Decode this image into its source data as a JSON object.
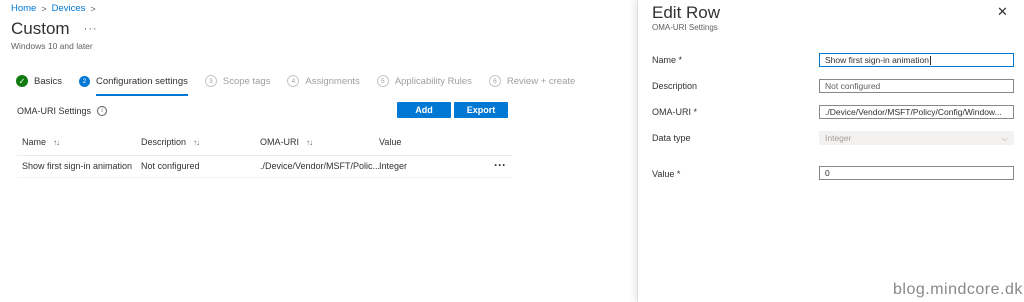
{
  "breadcrumb": {
    "home": "Home",
    "devices": "Devices",
    "sep": ">"
  },
  "page": {
    "title": "Custom",
    "more": "···",
    "subtitle": "Windows 10 and later"
  },
  "steps": [
    {
      "num": "✓",
      "label": "Basics",
      "state": "done"
    },
    {
      "num": "2",
      "label": "Configuration settings",
      "state": "active"
    },
    {
      "num": "3",
      "label": "Scope tags",
      "state": "pending"
    },
    {
      "num": "4",
      "label": "Assignments",
      "state": "pending"
    },
    {
      "num": "5",
      "label": "Applicability Rules",
      "state": "pending"
    },
    {
      "num": "6",
      "label": "Review + create",
      "state": "pending"
    }
  ],
  "oma_settings": {
    "label": "OMA-URI Settings",
    "info": "i"
  },
  "buttons": {
    "add": "Add",
    "export": "Export"
  },
  "table": {
    "headers": {
      "name": "Name",
      "description": "Description",
      "oma_uri": "OMA-URI",
      "value": "Value",
      "sort": "↑↓"
    },
    "rows": [
      {
        "name": "Show first sign-in animation",
        "description": "Not configured",
        "oma_uri": "./Device/Vendor/MSFT/Polic...",
        "value": "Integer",
        "more": "···"
      }
    ]
  },
  "panel": {
    "title": "Edit Row",
    "subtitle": "OMA-URI Settings",
    "close": "✕",
    "fields": {
      "name": {
        "label": "Name *",
        "value": "Show first sign-in animation"
      },
      "description": {
        "label": "Description",
        "value": "",
        "placeholder": "Not configured"
      },
      "oma_uri": {
        "label": "OMA-URI *",
        "value": "./Device/Vendor/MSFT/Policy/Config/Window..."
      },
      "data_type": {
        "label": "Data type",
        "value": "Integer",
        "chevron": "⌵"
      },
      "value": {
        "label": "Value *",
        "value": "0"
      }
    }
  },
  "watermark": "blog.mindcore.dk",
  "colors": {
    "accent": "#0078d4",
    "success": "#107c10"
  }
}
